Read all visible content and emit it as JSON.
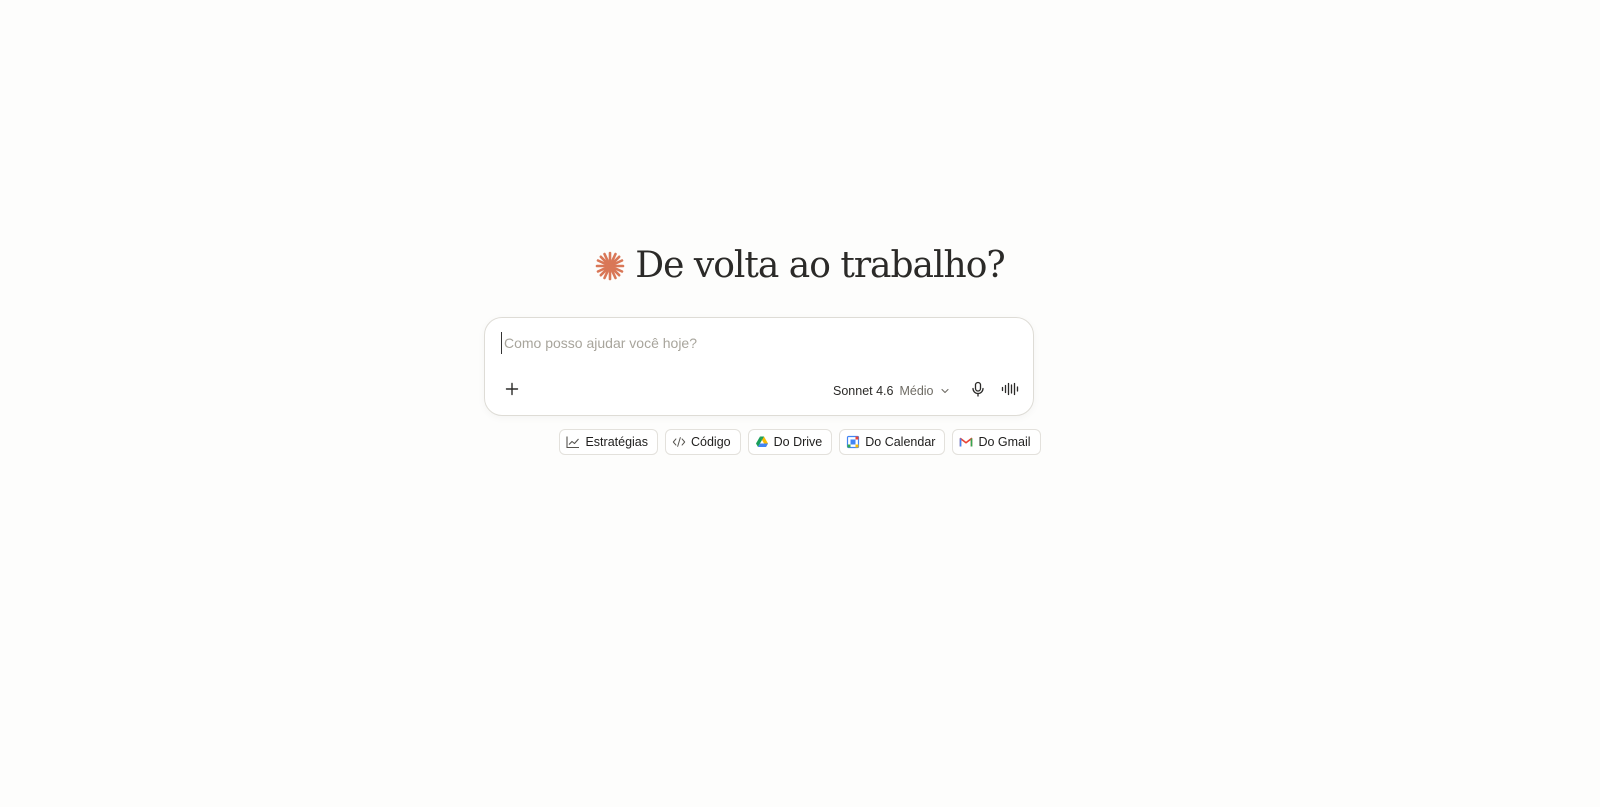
{
  "greeting": {
    "title": "De volta ao trabalho?",
    "icon": "spark-icon",
    "accent_color": "#d97757"
  },
  "composer": {
    "placeholder": "Como posso ajudar você hoje?",
    "value": "",
    "add_icon": "plus-icon",
    "model": {
      "name": "Sonnet 4.6",
      "effort": "Médio",
      "dropdown_icon": "chevron-down-icon"
    },
    "mic_icon": "microphone-icon",
    "voice_icon": "voice-waveform-icon"
  },
  "chips": [
    {
      "label": "Estratégias",
      "icon": "chart-line-icon"
    },
    {
      "label": "Código",
      "icon": "code-icon"
    },
    {
      "label": "Do Drive",
      "icon": "google-drive-icon"
    },
    {
      "label": "Do Calendar",
      "icon": "google-calendar-icon"
    },
    {
      "label": "Do Gmail",
      "icon": "gmail-icon"
    }
  ]
}
